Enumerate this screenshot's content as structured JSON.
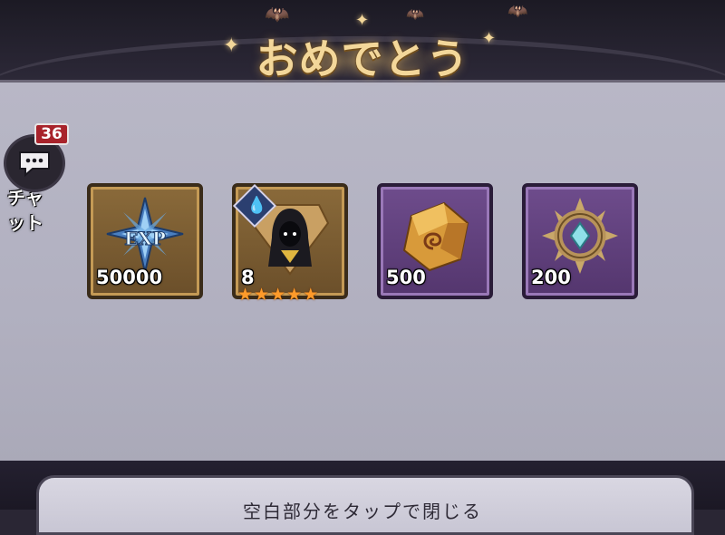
{
  "title": "おめでとう",
  "chat": {
    "badge": "36",
    "label_line1": "チャ",
    "label_line2": "ット"
  },
  "rewards": [
    {
      "icon": "exp-icon",
      "count": "50000",
      "frame": "gold"
    },
    {
      "icon": "hooded-hero-icon",
      "count": "8",
      "frame": "gold",
      "stars": 5,
      "element": "water"
    },
    {
      "icon": "ore-fragment-icon",
      "count": "500",
      "frame": "purple"
    },
    {
      "icon": "spiked-ring-icon",
      "count": "200",
      "frame": "purple"
    }
  ],
  "hint": "空白部分をタップで閉じる",
  "colors": {
    "gold_frame": "#c49a55",
    "purple_frame": "#9a78b8",
    "title": "#f3d79a",
    "badge": "#a8232b"
  }
}
